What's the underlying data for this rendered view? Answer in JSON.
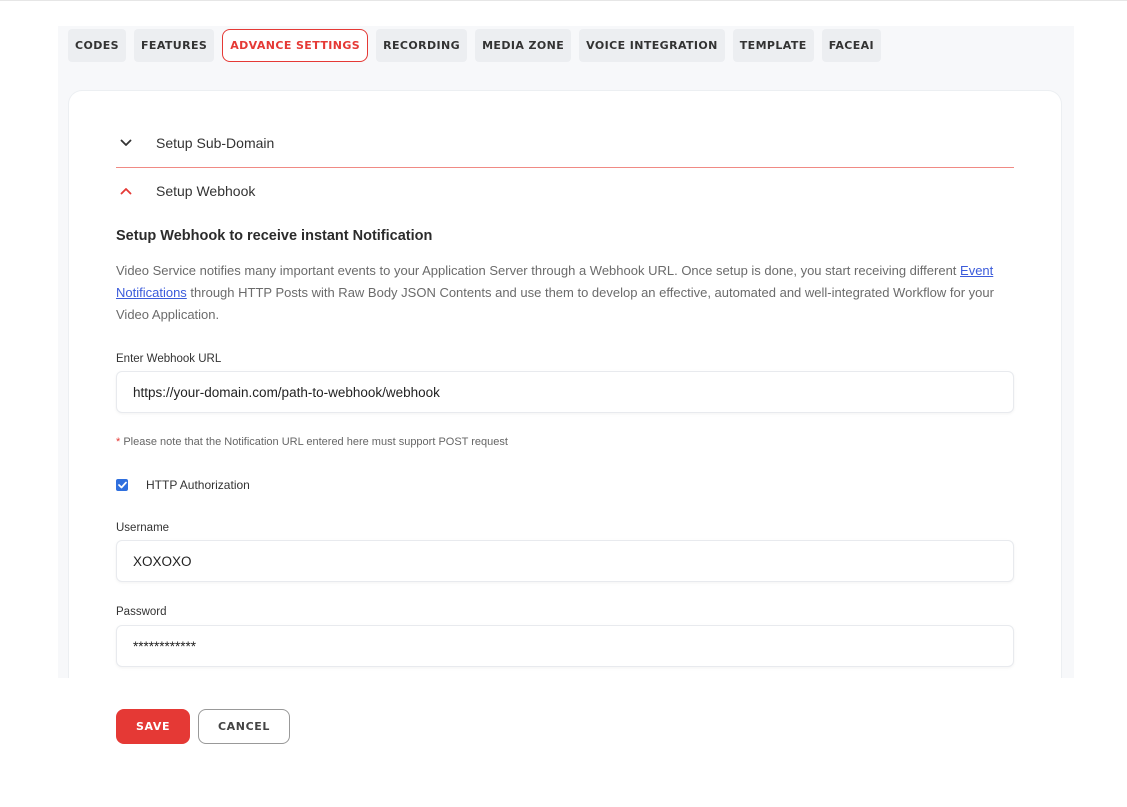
{
  "tabs": [
    {
      "label": "CODES",
      "active": false
    },
    {
      "label": "FEATURES",
      "active": false
    },
    {
      "label": "ADVANCE SETTINGS",
      "active": true
    },
    {
      "label": "RECORDING",
      "active": false
    },
    {
      "label": "MEDIA ZONE",
      "active": false
    },
    {
      "label": "VOICE INTEGRATION",
      "active": false
    },
    {
      "label": "TEMPLATE",
      "active": false
    },
    {
      "label": "FACEAI",
      "active": false
    }
  ],
  "accordion": {
    "subdomain": {
      "label": "Setup Sub-Domain",
      "icon": "chevron-down-icon",
      "expanded": false
    },
    "webhook": {
      "label": "Setup Webhook",
      "icon": "chevron-up-icon",
      "expanded": true
    }
  },
  "webhook": {
    "title": "Setup Webhook to receive instant Notification",
    "desc_part1": "Video Service notifies many important events to your Application Server through a Webhook URL. Once setup is done, you start receiving different ",
    "desc_link": "Event Notifications",
    "desc_part2": " through HTTP Posts with Raw Body JSON Contents and use them to develop an effective, automated and well-integrated Workflow for your Video Application.",
    "url_label": "Enter Webhook URL",
    "url_value": "https://your-domain.com/path-to-webhook/webhook",
    "note_star": "*",
    "note": " Please note that the Notification URL entered here must support POST request",
    "http_auth_label": "HTTP Authorization",
    "http_auth_checked": true,
    "username_label": "Username",
    "username_value": "XOXOXO",
    "password_label": "Password",
    "password_value": "************"
  },
  "actions": {
    "save_label": "SAVE",
    "cancel_label": "CANCEL"
  },
  "colors": {
    "accent": "#e53935",
    "link": "#3b5bdb",
    "checkbox": "#2f6fde"
  }
}
